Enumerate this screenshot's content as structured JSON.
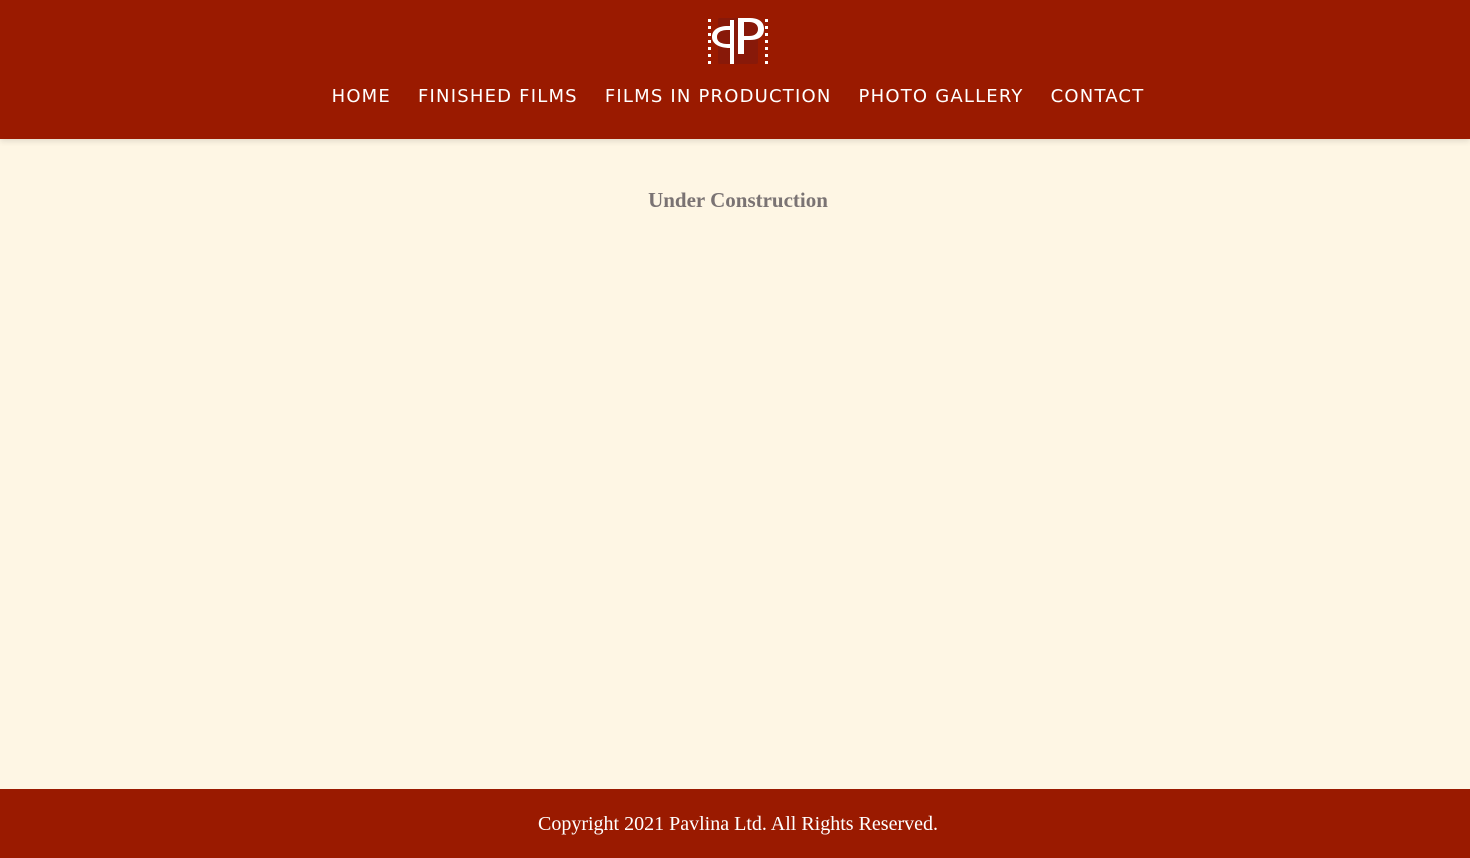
{
  "header": {
    "logo_icon": "pavlina-monogram-logo-icon",
    "nav": [
      {
        "label": "HOME"
      },
      {
        "label": "FINISHED FILMS"
      },
      {
        "label": "FILMS IN PRODUCTION"
      },
      {
        "label": "PHOTO GALLERY"
      },
      {
        "label": "CONTACT"
      }
    ]
  },
  "main": {
    "heading": "Under Construction"
  },
  "footer": {
    "copyright": "Copyright 2021 Pavlina Ltd. All Rights Reserved."
  },
  "colors": {
    "brand_red": "#9a1a00",
    "page_background": "#fef6e4",
    "heading_text": "#7a7373",
    "nav_text": "#ffffff"
  }
}
